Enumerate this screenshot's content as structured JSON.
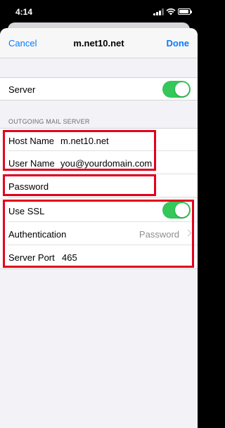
{
  "status_bar": {
    "time": "4:14"
  },
  "nav": {
    "cancel_label": "Cancel",
    "title": "m.net10.net",
    "done_label": "Done"
  },
  "server_row": {
    "label": "Server",
    "enabled": true
  },
  "outgoing": {
    "section_header": "OUTGOING MAIL SERVER",
    "host_name": {
      "label": "Host Name",
      "value": "m.net10.net"
    },
    "user_name": {
      "label": "User Name",
      "value": "you@yourdomain.com"
    },
    "password": {
      "label": "Password"
    },
    "use_ssl": {
      "label": "Use SSL",
      "enabled": true
    },
    "authentication": {
      "label": "Authentication",
      "value": "Password"
    },
    "server_port": {
      "label": "Server Port",
      "value": "465"
    }
  },
  "colors": {
    "accent": "#0a7aff",
    "toggle_on": "#34c759",
    "highlight": "#e3001b"
  },
  "icons": [
    "signal-icon",
    "wifi-icon",
    "battery-icon",
    "chevron-right-icon"
  ]
}
